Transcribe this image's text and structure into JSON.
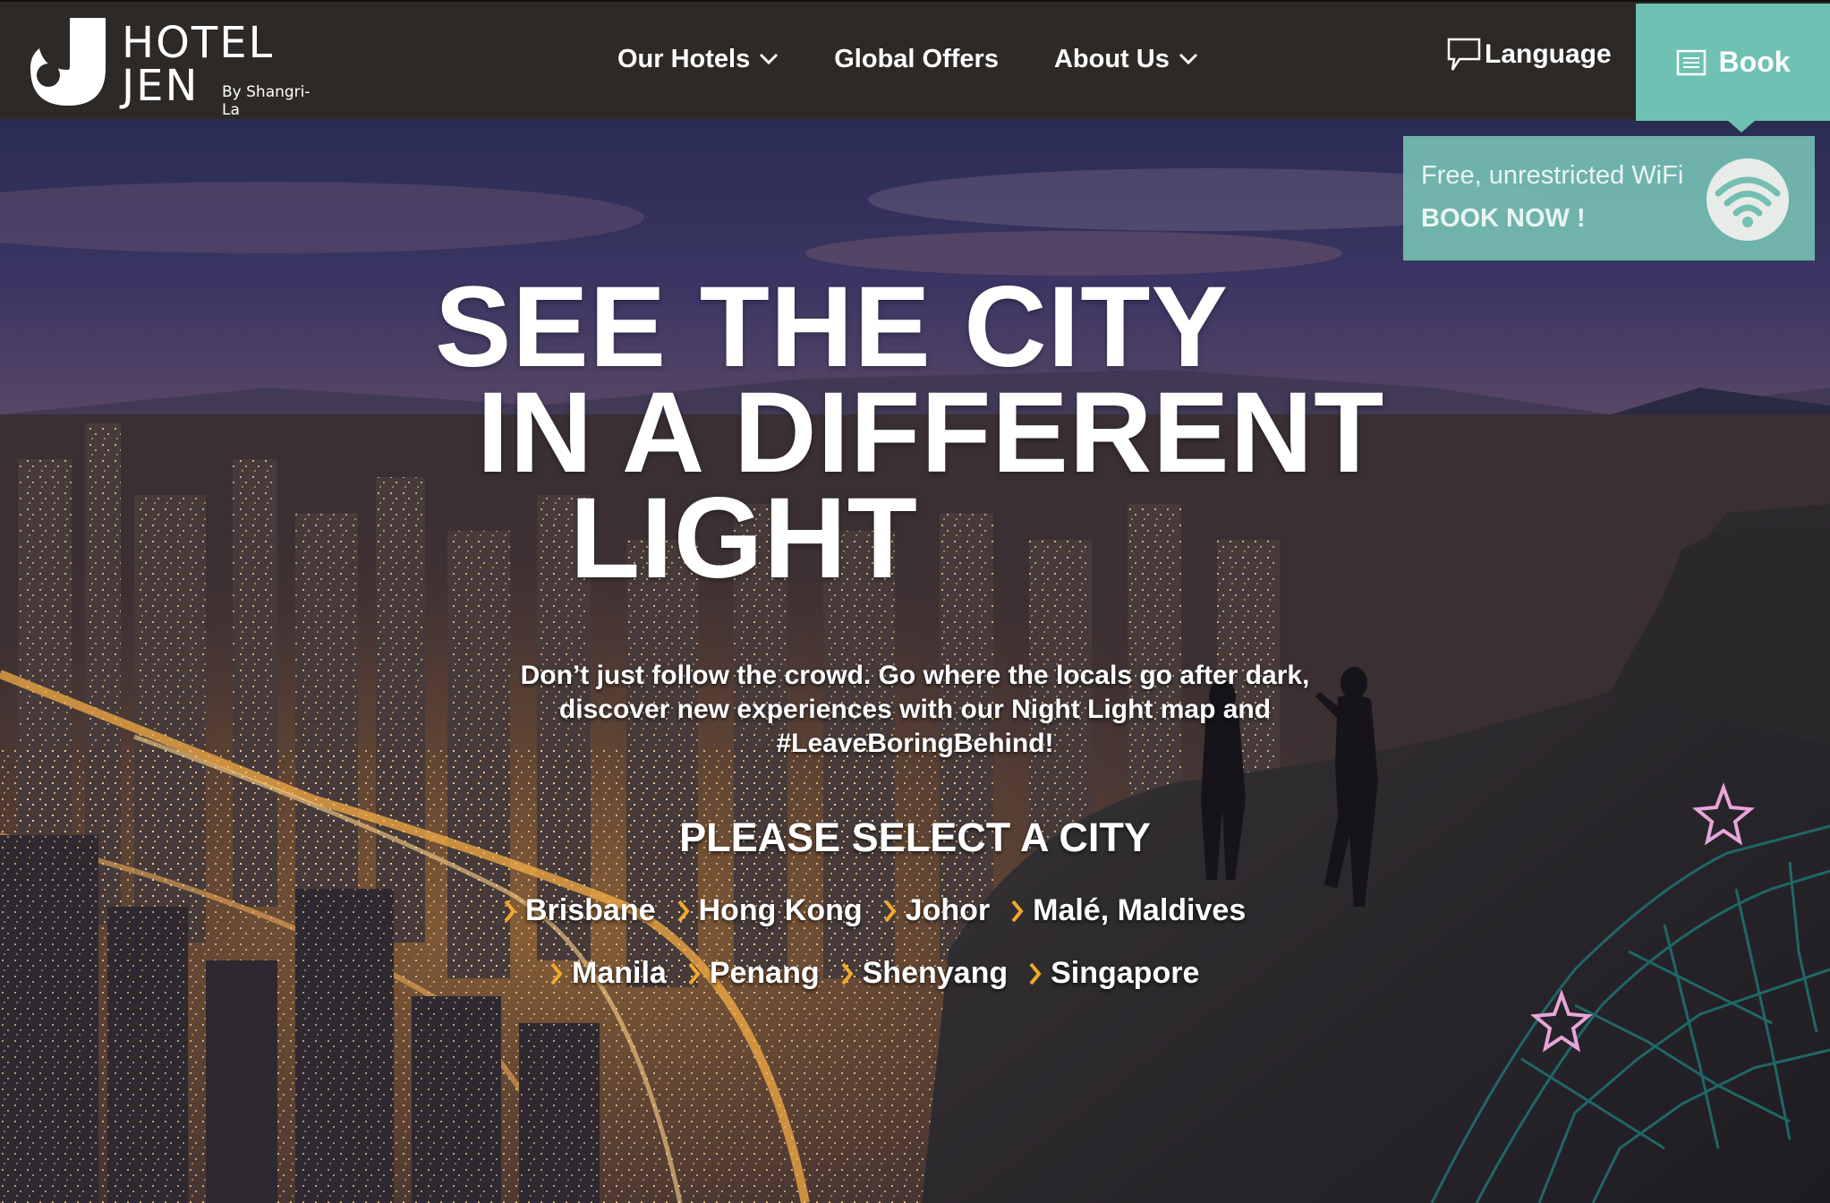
{
  "brand": {
    "line1": "HOTEL",
    "line2": "JEN",
    "sub": "By Shangri-La",
    "logo_icon": "j-logo-icon"
  },
  "nav": {
    "items": [
      {
        "label": "Our Hotels",
        "has_dropdown": true
      },
      {
        "label": "Global Offers",
        "has_dropdown": false
      },
      {
        "label": "About Us",
        "has_dropdown": true
      }
    ],
    "language": "Language",
    "book": "Book"
  },
  "promo": {
    "line1": "Free, unrestricted WiFi",
    "line2": "BOOK NOW !",
    "icon": "wifi-icon"
  },
  "hero": {
    "headline": [
      "SEE THE CITY",
      "IN A DIFFERENT",
      "LIGHT"
    ],
    "intro": "Don’t just follow the crowd. Go where the locals go after dark, discover new experiences with our Night Light map and #LeaveBoringBehind!",
    "select_title": "PLEASE SELECT A CITY",
    "cities_row1": [
      "Brisbane",
      "Hong Kong",
      "Johor",
      "Malé, Maldives"
    ],
    "cities_row2": [
      "Manila",
      "Penang",
      "Shenyang",
      "Singapore"
    ]
  },
  "colors": {
    "nav_bg": "#2d2926",
    "accent_teal": "#6ec1b3",
    "arrow_gold": "#f0a92a",
    "map_lines": "#1f6f6e",
    "star_pink": "#e7a5d8"
  }
}
